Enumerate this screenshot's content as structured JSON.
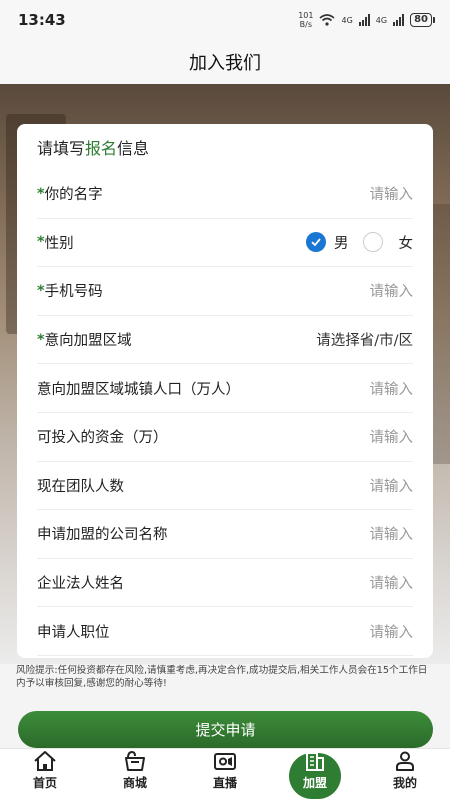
{
  "status": {
    "time": "13:43",
    "net_speed_top": "101",
    "net_speed_bottom": "B/s",
    "sig1": "4G",
    "sig2": "4G",
    "battery": "80"
  },
  "header": {
    "title": "加入我们"
  },
  "form": {
    "heading_pre": "请填写",
    "heading_highlight": "报名",
    "heading_post": "信息",
    "rows": [
      {
        "required": "*",
        "label": "你的名字",
        "value": "请输入"
      },
      {
        "required": "*",
        "label": "性别"
      },
      {
        "required": "*",
        "label": "手机号码",
        "value": "请输入"
      },
      {
        "required": "*",
        "label": "意向加盟区域",
        "value": "请选择省/市/区"
      },
      {
        "required": "",
        "label": "意向加盟区域城镇人口（万人）",
        "value": "请输入"
      },
      {
        "required": "",
        "label": "可投入的资金（万）",
        "value": "请输入"
      },
      {
        "required": "",
        "label": "现在团队人数",
        "value": "请输入"
      },
      {
        "required": "",
        "label": "申请加盟的公司名称",
        "value": "请输入"
      },
      {
        "required": "",
        "label": "企业法人姓名",
        "value": "请输入"
      },
      {
        "required": "",
        "label": "申请人职位",
        "value": "请输入"
      }
    ],
    "gender_options": {
      "male": "男",
      "female": "女",
      "selected": "男"
    }
  },
  "risk_notice": "风险提示:任何投资都存在风险,请慎重考虑,再决定合作,成功提交后,相关工作人员会在15个工作日内予以审核回复,感谢您的耐心等待!",
  "submit_label": "提交申请",
  "tabs": [
    {
      "label": "首页",
      "icon": "home-icon"
    },
    {
      "label": "商城",
      "icon": "shop-icon"
    },
    {
      "label": "直播",
      "icon": "live-icon"
    },
    {
      "label": "加盟",
      "icon": "join-icon",
      "active": true
    },
    {
      "label": "我的",
      "icon": "profile-icon"
    }
  ],
  "colors": {
    "accent": "#2e7d32",
    "radio": "#1976d2"
  }
}
